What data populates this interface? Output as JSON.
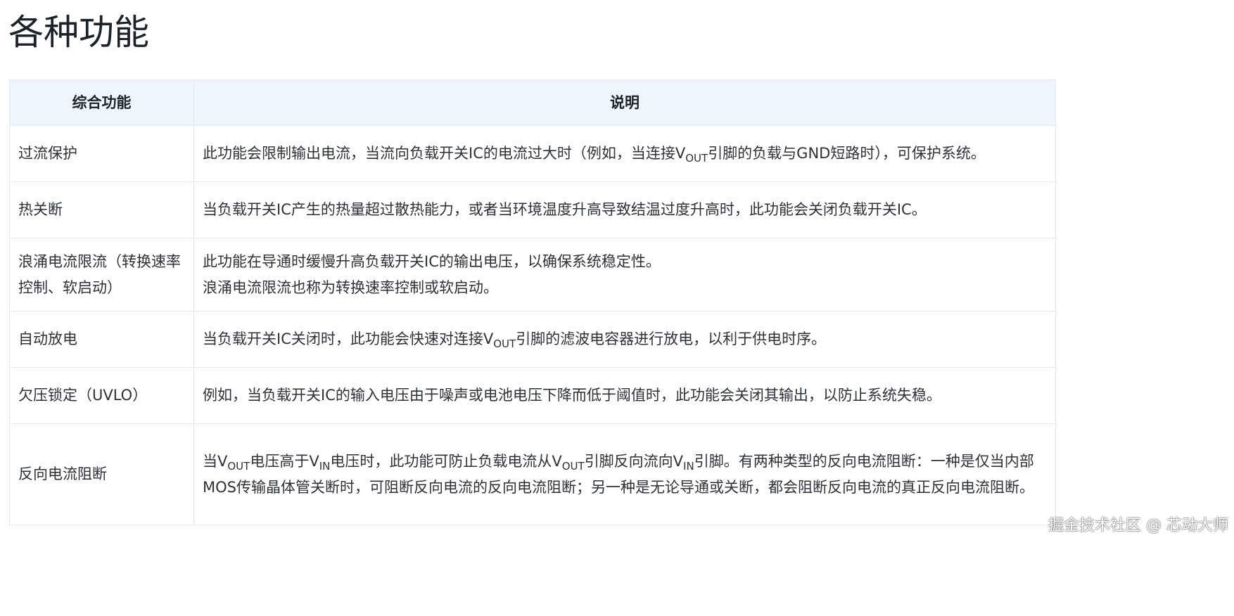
{
  "title": "各种功能",
  "table": {
    "headers": [
      "综合功能",
      "说明"
    ],
    "rows": [
      {
        "feature": "过流保护",
        "desc_parts": [
          "此功能会限制输出电流，当流向负载开关IC的电流过大时（例如，当连接V",
          "OUT",
          "引脚的负载与GND短路时），可保护系统。"
        ]
      },
      {
        "feature": "热关断",
        "desc": "当负载开关IC产生的热量超过散热能力，或者当环境温度升高导致结温过度升高时，此功能会关闭负载开关IC。"
      },
      {
        "feature": "浪涌电流限流（转换速率控制、软启动）",
        "desc_lines": [
          "此功能在导通时缓慢升高负载开关IC的输出电压，以确保系统稳定性。",
          "浪涌电流限流也称为转换速率控制或软启动。"
        ]
      },
      {
        "feature": "自动放电",
        "desc_parts": [
          "当负载开关IC关闭时，此功能会快速对连接V",
          "OUT",
          "引脚的滤波电容器进行放电，以利于供电时序。"
        ]
      },
      {
        "feature": "欠压锁定（UVLO）",
        "desc": "例如，当负载开关IC的输入电压由于噪声或电池电压下降而低于阈值时，此功能会关闭其输出，以防止系统失稳。"
      },
      {
        "feature": "反向电流阻断",
        "desc_parts": [
          "当V",
          "OUT",
          "电压高于V",
          "IN",
          "电压时，此功能可防止负载电流从V",
          "OUT",
          "引脚反向流向V",
          "IN",
          "引脚。有两种类型的反向电流阻断：一种是仅当内部MOS传输晶体管关断时，可阻断反向电流的反向电流阻断；另一种是无论导通或关断，都会阻断反向电流的真正反向电流阻断。"
        ]
      }
    ]
  },
  "watermark": "掘金技术社区 @ 芯动大师"
}
